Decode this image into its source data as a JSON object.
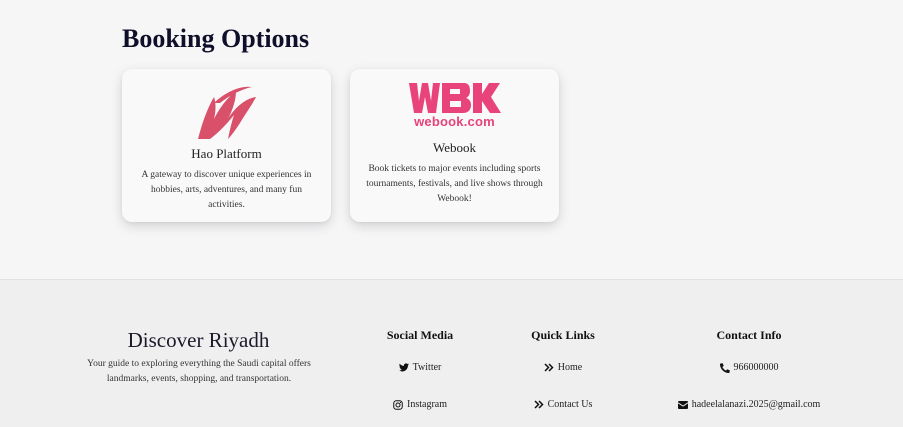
{
  "booking": {
    "title": "Booking Options",
    "cards": [
      {
        "name": "Hao Platform",
        "description": "A gateway to discover unique experiences in hobbies, arts, adventures, and many fun activities.",
        "logo_icon": "hao-logo"
      },
      {
        "name": "Webook",
        "description": "Book tickets to major events including sports tournaments, festivals, and live shows through Webook!",
        "logo_icon": "webook-logo",
        "logo_text": "webook.com"
      }
    ]
  },
  "footer": {
    "brand_title": "Discover Riyadh",
    "brand_desc": "Your guide to exploring everything the Saudi capital offers landmarks, events, shopping, and transportation.",
    "social": {
      "title": "Social Media",
      "links": [
        {
          "label": "Twitter",
          "icon": "twitter-icon"
        },
        {
          "label": "Instagram",
          "icon": "instagram-icon"
        }
      ]
    },
    "quick": {
      "title": "Quick Links",
      "links": [
        {
          "label": "Home",
          "icon": "double-chevron-right-icon"
        },
        {
          "label": "Contact Us",
          "icon": "double-chevron-right-icon"
        }
      ]
    },
    "contact": {
      "title": "Contact Info",
      "phone": "966000000",
      "email": "hadeelalanazi.2025@gmail.com"
    }
  },
  "colors": {
    "brand_pink": "#e8437a",
    "hao_red": "#d9506a",
    "page_bg": "#f6f6f7",
    "footer_bg": "#efeff0"
  }
}
